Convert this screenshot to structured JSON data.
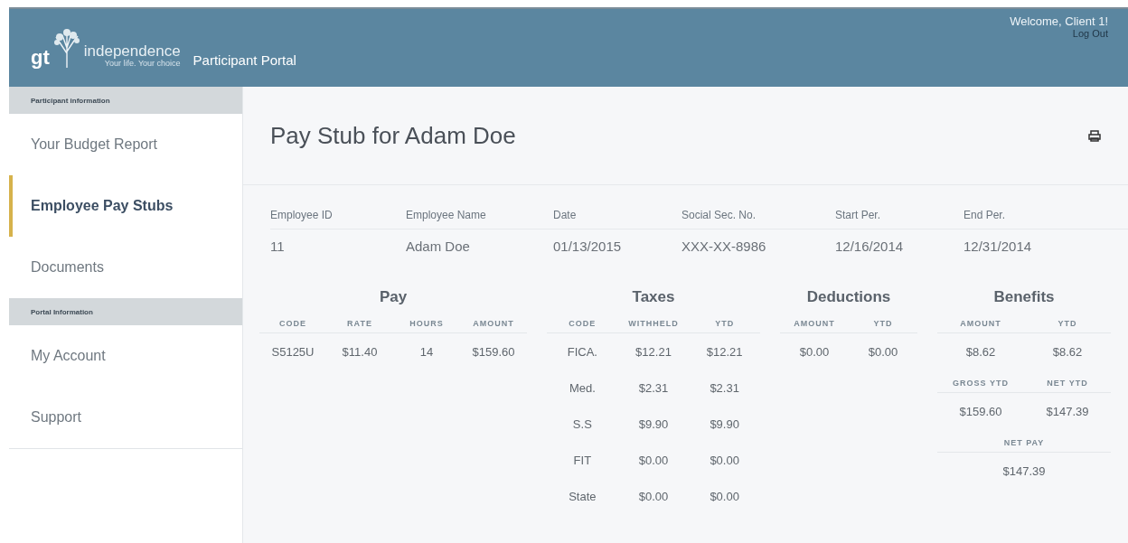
{
  "header": {
    "logo": {
      "mark": "gt",
      "name": "independence",
      "tagline": "Your life. Your choice"
    },
    "portal_title": "Participant Portal",
    "welcome": "Welcome, Client 1!",
    "logout": "Log Out"
  },
  "sidebar": {
    "sections": [
      {
        "heading": "Participant information",
        "items": [
          {
            "label": "Your Budget Report",
            "selected": false
          },
          {
            "label": "Employee Pay Stubs",
            "selected": true
          },
          {
            "label": "Documents",
            "selected": false
          }
        ]
      },
      {
        "heading": "Portal Information",
        "items": [
          {
            "label": "My Account",
            "selected": false
          },
          {
            "label": "Support",
            "selected": false
          }
        ]
      }
    ]
  },
  "page_title": "Pay Stub for Adam Doe",
  "employee_info": {
    "columns": [
      "Employee ID",
      "Employee Name",
      "Date",
      "Social Sec. No.",
      "Start Per.",
      "End Per."
    ],
    "values": [
      "11",
      "Adam Doe",
      "01/13/2015",
      "XXX-XX-8986",
      "12/16/2014",
      "12/31/2014"
    ]
  },
  "sections": [
    {
      "title": "Pay",
      "tables": [
        {
          "columns": [
            "CODE",
            "RATE",
            "HOURS",
            "AMOUNT"
          ],
          "rows": [
            [
              "S5125U",
              "$11.40",
              "14",
              "$159.60"
            ]
          ]
        }
      ]
    },
    {
      "title": "Taxes",
      "tables": [
        {
          "columns": [
            "CODE",
            "WITHHELD",
            "YTD"
          ],
          "rows": [
            [
              "FICA.",
              "$12.21",
              "$12.21"
            ],
            [
              "Med.",
              "$2.31",
              "$2.31"
            ],
            [
              "S.S",
              "$9.90",
              "$9.90"
            ],
            [
              "FIT",
              "$0.00",
              "$0.00"
            ],
            [
              "State",
              "$0.00",
              "$0.00"
            ]
          ]
        }
      ]
    },
    {
      "title": "Deductions",
      "tables": [
        {
          "columns": [
            "AMOUNT",
            "YTD"
          ],
          "rows": [
            [
              "$0.00",
              "$0.00"
            ]
          ]
        }
      ]
    },
    {
      "title": "Benefits",
      "tables": [
        {
          "columns": [
            "AMOUNT",
            "YTD"
          ],
          "rows": [
            [
              "$8.62",
              "$8.62"
            ]
          ]
        },
        {
          "columns": [
            "GROSS YTD",
            "NET YTD"
          ],
          "rows": [
            [
              "$159.60",
              "$147.39"
            ]
          ]
        },
        {
          "columns": [
            "NET PAY"
          ],
          "rows": [
            [
              "$147.39"
            ]
          ]
        }
      ]
    }
  ]
}
